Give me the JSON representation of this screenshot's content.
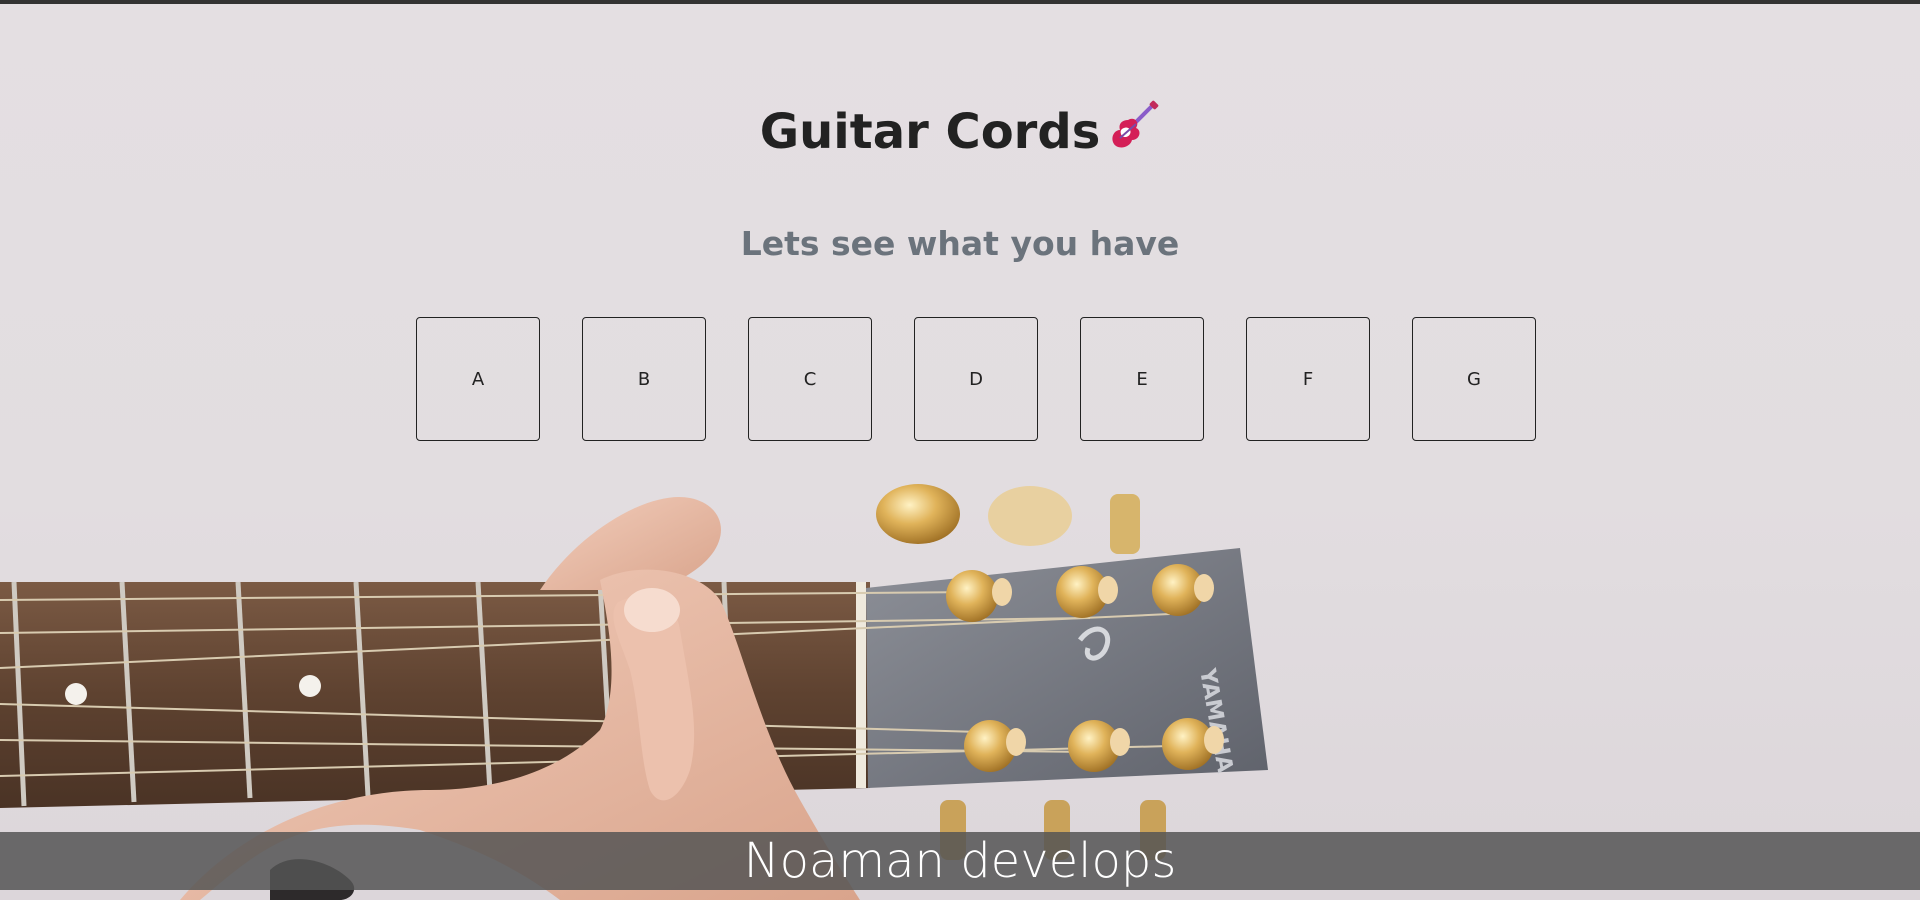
{
  "header": {
    "title": "Guitar Cords",
    "title_icon": "guitar-icon",
    "subtitle": "Lets see what you have"
  },
  "chords": [
    {
      "label": "A"
    },
    {
      "label": "B"
    },
    {
      "label": "C"
    },
    {
      "label": "D"
    },
    {
      "label": "E"
    },
    {
      "label": "F"
    },
    {
      "label": "G"
    }
  ],
  "footer": {
    "text": "Noaman develops"
  },
  "colors": {
    "background": "#e3dee1",
    "title": "#222222",
    "subtitle": "#6b737c",
    "footer_bg": "#555555",
    "fretboard": "#6b4a35",
    "headstock": "#7a7c84",
    "tuner_gold": "#d9a84a"
  }
}
